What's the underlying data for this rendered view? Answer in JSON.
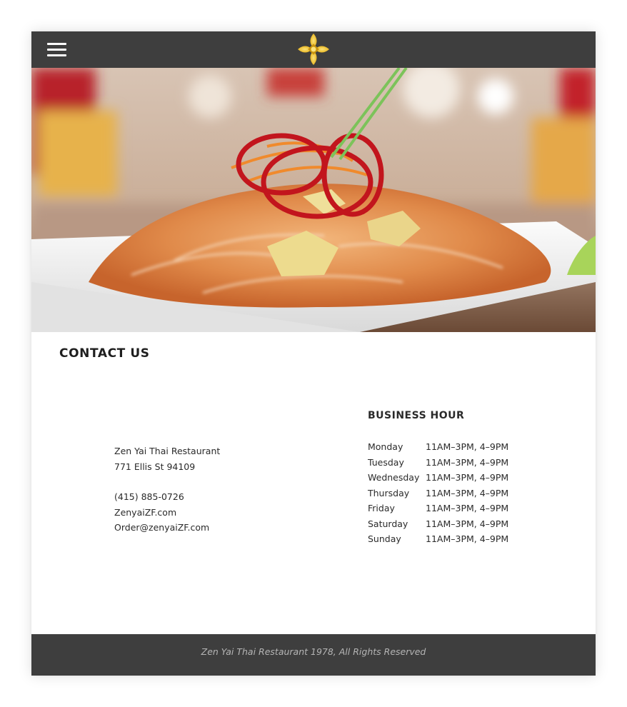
{
  "header": {
    "menu_icon": "hamburger-menu-icon",
    "logo_icon": "lotus-flower-logo-icon",
    "bar_color": "#3e3e3e",
    "logo_color": "#f2c21b"
  },
  "hero": {
    "image": "pad-thai-dish-photo"
  },
  "contact": {
    "title": "CONTACT US",
    "restaurant_name": "Zen Yai Thai Restaurant",
    "street": "771 Ellis St 94109",
    "phone": "(415) 885-0726",
    "website": "ZenyaiZF.com",
    "email": "Order@zenyaiZF.com"
  },
  "business_hours": {
    "title": "BUSINESS HOUR",
    "days": [
      {
        "day": "Monday",
        "hours": "11AM–3PM, 4–9PM"
      },
      {
        "day": "Tuesday",
        "hours": "11AM–3PM, 4–9PM"
      },
      {
        "day": "Wednesday",
        "hours": "11AM–3PM, 4–9PM"
      },
      {
        "day": "Thursday",
        "hours": "11AM–3PM, 4–9PM"
      },
      {
        "day": "Friday",
        "hours": "11AM–3PM, 4–9PM"
      },
      {
        "day": "Saturday",
        "hours": "11AM–3PM, 4–9PM"
      },
      {
        "day": "Sunday",
        "hours": "11AM–3PM, 4–9PM"
      }
    ]
  },
  "footer": {
    "copyright": "Zen Yai Thai Restaurant 1978, All Rights Reserved"
  }
}
